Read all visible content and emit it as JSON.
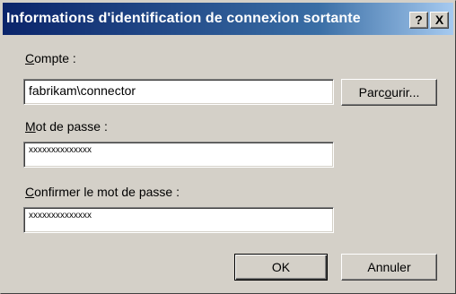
{
  "window": {
    "title": "Informations d'identification de connexion sortante",
    "help_label": "?",
    "close_label": "X"
  },
  "account": {
    "label_accel": "C",
    "label_rest": "ompte :",
    "value": "fabrikam\\connector"
  },
  "browse_button": {
    "label_pre": "Parc",
    "label_accel": "o",
    "label_post": "urir..."
  },
  "password": {
    "label_accel": "M",
    "label_rest": "ot de passe :",
    "value": "xxxxxxxxxxxxxx"
  },
  "confirm": {
    "label_accel": "C",
    "label_rest": "onfirmer le mot de passe :",
    "value": "xxxxxxxxxxxxxx"
  },
  "buttons": {
    "ok_label": "OK",
    "cancel_label": "Annuler"
  }
}
